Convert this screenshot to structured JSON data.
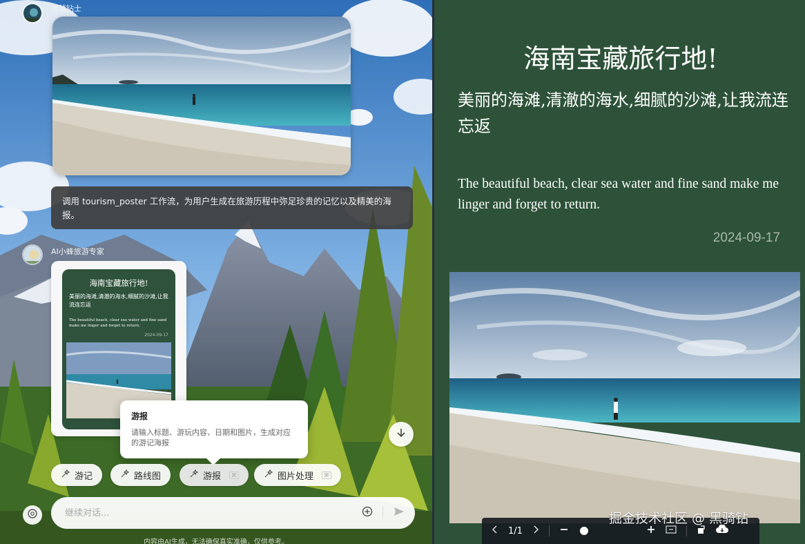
{
  "chat": {
    "user_name": "黑骑钻士",
    "workflow_message": "调用 tourism_poster 工作流，为用户生成在旅游历程中弥足珍贵的记忆以及精美的海报。",
    "bot_name": "AI小蜂旅游专家",
    "poster_thumb": {
      "title": "海南宝藏旅行地!",
      "subtitle": "美丽的海滩,清澈的海水,细腻的沙滩,让我流连忘返",
      "english": "The beautiful beach, clear sea water and fine sand make me linger and forget to return.",
      "date": "2024-09-17"
    },
    "tooltip": {
      "title": "游报",
      "description": "请输入标题、游玩内容、日期和图片，生成对应的游记海报"
    },
    "chips": [
      {
        "label": "游记"
      },
      {
        "label": "路线图"
      },
      {
        "label": "游报"
      },
      {
        "label": "图片处理"
      }
    ],
    "input_placeholder": "继续对话...",
    "disclaimer": "内容由AI生成，无法确保真实准确，仅供参考。"
  },
  "poster": {
    "title": "海南宝藏旅行地!",
    "subtitle": "美丽的海滩,清澈的海水,细腻的沙滩,让我流连忘返",
    "english": "The beautiful beach, clear sea water and fine sand make me linger and forget to return.",
    "date": "2024-09-17"
  },
  "viewer": {
    "page_indicator": "1/1"
  },
  "watermark": "掘金技术社区 @ 黑骑钻",
  "icons": [
    "sparkle-icon",
    "arrow-down-icon",
    "plus-circle-icon",
    "send-icon",
    "settings-icon",
    "chevron-left-icon",
    "chevron-right-icon",
    "zoom-out-icon",
    "zoom-in-icon",
    "fit-icon",
    "rotate-icon",
    "download-icon"
  ],
  "colors": {
    "poster_green": "#2d5239",
    "bubble_dark": "#3e3e3e",
    "date_gray": "#a9b7ab"
  }
}
